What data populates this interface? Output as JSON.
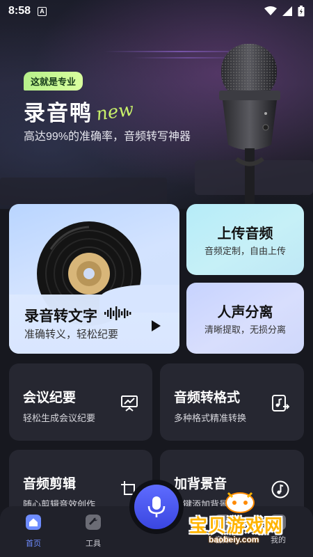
{
  "status_bar": {
    "time": "8:58",
    "notification_icon": "a-icon",
    "icons": [
      "wifi-icon",
      "signal-icon",
      "battery-icon"
    ]
  },
  "hero": {
    "tag": "这就是专业",
    "app_name": "录音鸭",
    "script_word": "new",
    "subtitle": "高达99%的准确率，音频转写神器"
  },
  "cards": {
    "main": {
      "title": "录音转文字",
      "desc": "准确转义，轻松纪要"
    },
    "upload": {
      "title": "上传音频",
      "desc": "音频定制，自由上传"
    },
    "voice": {
      "title": "人声分离",
      "desc": "清晰提取，无损分离"
    }
  },
  "tools": [
    {
      "title": "会议纪要",
      "desc": "轻松生成会议纪要",
      "icon": "presentation-chart-icon"
    },
    {
      "title": "音频转格式",
      "desc": "多种格式精准转换",
      "icon": "music-file-convert-icon"
    },
    {
      "title": "音频剪辑",
      "desc": "随心剪辑音效创作",
      "icon": "crop-icon"
    },
    {
      "title": "加背景音",
      "desc": "一键添加背景音",
      "icon": "music-note-icon"
    }
  ],
  "bottom_nav": {
    "home": "首页",
    "tools": "工具",
    "library": "音库",
    "mine": "我的",
    "fab_icon": "microphone-icon"
  },
  "watermark": {
    "text": "宝贝游戏网",
    "url": "baobeiy.com"
  },
  "colors": {
    "background": "#17181f",
    "tool_card": "#262731",
    "accent_blue": "#4a57f0",
    "tag_green": "#c8f08a",
    "nav_active": "#6e8cff"
  }
}
